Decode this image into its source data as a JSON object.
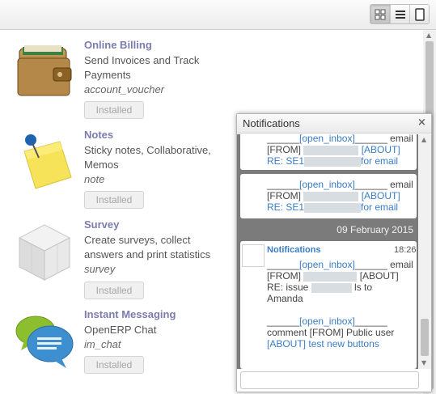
{
  "toolbar": {
    "views": [
      {
        "name": "kanban-view",
        "icon": "grid-icon"
      },
      {
        "name": "list-view",
        "icon": "list-icon"
      },
      {
        "name": "form-view",
        "icon": "form-icon"
      }
    ]
  },
  "modules": [
    {
      "title": "Online Billing",
      "description": "Send Invoices and Track Payments",
      "technical_name": "account_voucher",
      "button": "Installed",
      "icon": "wallet-icon"
    },
    {
      "title": "Notes",
      "description": "Sticky notes, Collaborative, Memos",
      "technical_name": "note",
      "button": "Installed",
      "icon": "sticky-note-icon"
    },
    {
      "title": "Survey",
      "description": "Create surveys, collect answers and print statistics",
      "technical_name": "survey",
      "button": "Installed",
      "icon": "cube-icon"
    },
    {
      "title": "Instant Messaging",
      "description": "OpenERP Chat",
      "technical_name": "im_chat",
      "button": "Installed",
      "icon": "chat-bubbles-icon"
    }
  ],
  "notifications": {
    "title": "Notifications",
    "close": "×",
    "messages": [
      {
        "inbox_prefix": "______",
        "inbox_link": "[open_inbox]",
        "inbox_suffix": "______ email",
        "from_line": "[FROM]",
        "about_link": "[ABOUT]",
        "about_text": "RE: SE1",
        "tail": "for email"
      },
      {
        "inbox_prefix": "______",
        "inbox_link": "[open_inbox]",
        "inbox_suffix": "______ email",
        "from_line": "[FROM]",
        "about_link": "[ABOUT]",
        "about_text": "RE: SE1",
        "tail": "for email"
      }
    ],
    "date_separator": "09 February 2015",
    "last": {
      "author": "Notifications",
      "time": "18:26",
      "line1_prefix": "______",
      "line1_link": "[open_inbox]",
      "line1_suffix": "______ email",
      "from": "[FROM]",
      "about_link": "[ABOUT]",
      "about_text": "RE: issue",
      "about_tail": "ls to",
      "name": "Amanda",
      "line2_prefix": "______",
      "line2_link": "[open_inbox]",
      "line2_suffix": "______",
      "comment": "comment [FROM] Public user",
      "about2_link": "[ABOUT]",
      "about2_text": "test new buttons"
    },
    "input_placeholder": ""
  }
}
